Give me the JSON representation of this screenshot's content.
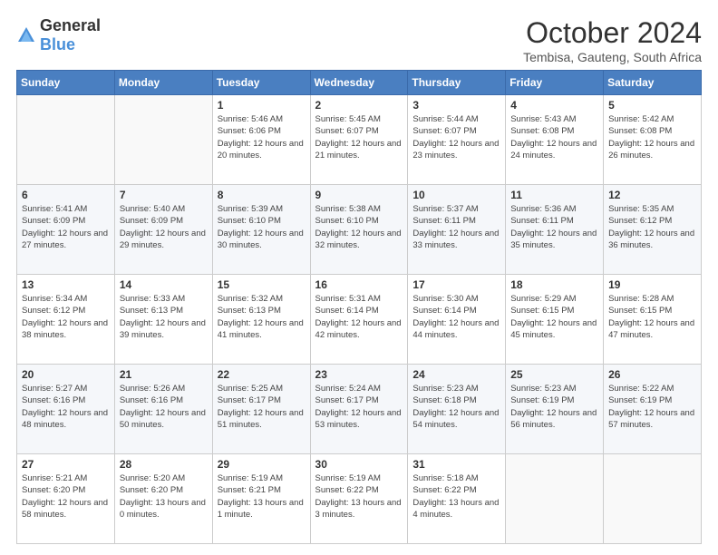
{
  "logo": {
    "text_general": "General",
    "text_blue": "Blue"
  },
  "title": "October 2024",
  "subtitle": "Tembisa, Gauteng, South Africa",
  "days_of_week": [
    "Sunday",
    "Monday",
    "Tuesday",
    "Wednesday",
    "Thursday",
    "Friday",
    "Saturday"
  ],
  "weeks": [
    [
      {
        "day": "",
        "sunrise": "",
        "sunset": "",
        "daylight": ""
      },
      {
        "day": "",
        "sunrise": "",
        "sunset": "",
        "daylight": ""
      },
      {
        "day": "1",
        "sunrise": "Sunrise: 5:46 AM",
        "sunset": "Sunset: 6:06 PM",
        "daylight": "Daylight: 12 hours and 20 minutes."
      },
      {
        "day": "2",
        "sunrise": "Sunrise: 5:45 AM",
        "sunset": "Sunset: 6:07 PM",
        "daylight": "Daylight: 12 hours and 21 minutes."
      },
      {
        "day": "3",
        "sunrise": "Sunrise: 5:44 AM",
        "sunset": "Sunset: 6:07 PM",
        "daylight": "Daylight: 12 hours and 23 minutes."
      },
      {
        "day": "4",
        "sunrise": "Sunrise: 5:43 AM",
        "sunset": "Sunset: 6:08 PM",
        "daylight": "Daylight: 12 hours and 24 minutes."
      },
      {
        "day": "5",
        "sunrise": "Sunrise: 5:42 AM",
        "sunset": "Sunset: 6:08 PM",
        "daylight": "Daylight: 12 hours and 26 minutes."
      }
    ],
    [
      {
        "day": "6",
        "sunrise": "Sunrise: 5:41 AM",
        "sunset": "Sunset: 6:09 PM",
        "daylight": "Daylight: 12 hours and 27 minutes."
      },
      {
        "day": "7",
        "sunrise": "Sunrise: 5:40 AM",
        "sunset": "Sunset: 6:09 PM",
        "daylight": "Daylight: 12 hours and 29 minutes."
      },
      {
        "day": "8",
        "sunrise": "Sunrise: 5:39 AM",
        "sunset": "Sunset: 6:10 PM",
        "daylight": "Daylight: 12 hours and 30 minutes."
      },
      {
        "day": "9",
        "sunrise": "Sunrise: 5:38 AM",
        "sunset": "Sunset: 6:10 PM",
        "daylight": "Daylight: 12 hours and 32 minutes."
      },
      {
        "day": "10",
        "sunrise": "Sunrise: 5:37 AM",
        "sunset": "Sunset: 6:11 PM",
        "daylight": "Daylight: 12 hours and 33 minutes."
      },
      {
        "day": "11",
        "sunrise": "Sunrise: 5:36 AM",
        "sunset": "Sunset: 6:11 PM",
        "daylight": "Daylight: 12 hours and 35 minutes."
      },
      {
        "day": "12",
        "sunrise": "Sunrise: 5:35 AM",
        "sunset": "Sunset: 6:12 PM",
        "daylight": "Daylight: 12 hours and 36 minutes."
      }
    ],
    [
      {
        "day": "13",
        "sunrise": "Sunrise: 5:34 AM",
        "sunset": "Sunset: 6:12 PM",
        "daylight": "Daylight: 12 hours and 38 minutes."
      },
      {
        "day": "14",
        "sunrise": "Sunrise: 5:33 AM",
        "sunset": "Sunset: 6:13 PM",
        "daylight": "Daylight: 12 hours and 39 minutes."
      },
      {
        "day": "15",
        "sunrise": "Sunrise: 5:32 AM",
        "sunset": "Sunset: 6:13 PM",
        "daylight": "Daylight: 12 hours and 41 minutes."
      },
      {
        "day": "16",
        "sunrise": "Sunrise: 5:31 AM",
        "sunset": "Sunset: 6:14 PM",
        "daylight": "Daylight: 12 hours and 42 minutes."
      },
      {
        "day": "17",
        "sunrise": "Sunrise: 5:30 AM",
        "sunset": "Sunset: 6:14 PM",
        "daylight": "Daylight: 12 hours and 44 minutes."
      },
      {
        "day": "18",
        "sunrise": "Sunrise: 5:29 AM",
        "sunset": "Sunset: 6:15 PM",
        "daylight": "Daylight: 12 hours and 45 minutes."
      },
      {
        "day": "19",
        "sunrise": "Sunrise: 5:28 AM",
        "sunset": "Sunset: 6:15 PM",
        "daylight": "Daylight: 12 hours and 47 minutes."
      }
    ],
    [
      {
        "day": "20",
        "sunrise": "Sunrise: 5:27 AM",
        "sunset": "Sunset: 6:16 PM",
        "daylight": "Daylight: 12 hours and 48 minutes."
      },
      {
        "day": "21",
        "sunrise": "Sunrise: 5:26 AM",
        "sunset": "Sunset: 6:16 PM",
        "daylight": "Daylight: 12 hours and 50 minutes."
      },
      {
        "day": "22",
        "sunrise": "Sunrise: 5:25 AM",
        "sunset": "Sunset: 6:17 PM",
        "daylight": "Daylight: 12 hours and 51 minutes."
      },
      {
        "day": "23",
        "sunrise": "Sunrise: 5:24 AM",
        "sunset": "Sunset: 6:17 PM",
        "daylight": "Daylight: 12 hours and 53 minutes."
      },
      {
        "day": "24",
        "sunrise": "Sunrise: 5:23 AM",
        "sunset": "Sunset: 6:18 PM",
        "daylight": "Daylight: 12 hours and 54 minutes."
      },
      {
        "day": "25",
        "sunrise": "Sunrise: 5:23 AM",
        "sunset": "Sunset: 6:19 PM",
        "daylight": "Daylight: 12 hours and 56 minutes."
      },
      {
        "day": "26",
        "sunrise": "Sunrise: 5:22 AM",
        "sunset": "Sunset: 6:19 PM",
        "daylight": "Daylight: 12 hours and 57 minutes."
      }
    ],
    [
      {
        "day": "27",
        "sunrise": "Sunrise: 5:21 AM",
        "sunset": "Sunset: 6:20 PM",
        "daylight": "Daylight: 12 hours and 58 minutes."
      },
      {
        "day": "28",
        "sunrise": "Sunrise: 5:20 AM",
        "sunset": "Sunset: 6:20 PM",
        "daylight": "Daylight: 13 hours and 0 minutes."
      },
      {
        "day": "29",
        "sunrise": "Sunrise: 5:19 AM",
        "sunset": "Sunset: 6:21 PM",
        "daylight": "Daylight: 13 hours and 1 minute."
      },
      {
        "day": "30",
        "sunrise": "Sunrise: 5:19 AM",
        "sunset": "Sunset: 6:22 PM",
        "daylight": "Daylight: 13 hours and 3 minutes."
      },
      {
        "day": "31",
        "sunrise": "Sunrise: 5:18 AM",
        "sunset": "Sunset: 6:22 PM",
        "daylight": "Daylight: 13 hours and 4 minutes."
      },
      {
        "day": "",
        "sunrise": "",
        "sunset": "",
        "daylight": ""
      },
      {
        "day": "",
        "sunrise": "",
        "sunset": "",
        "daylight": ""
      }
    ]
  ]
}
